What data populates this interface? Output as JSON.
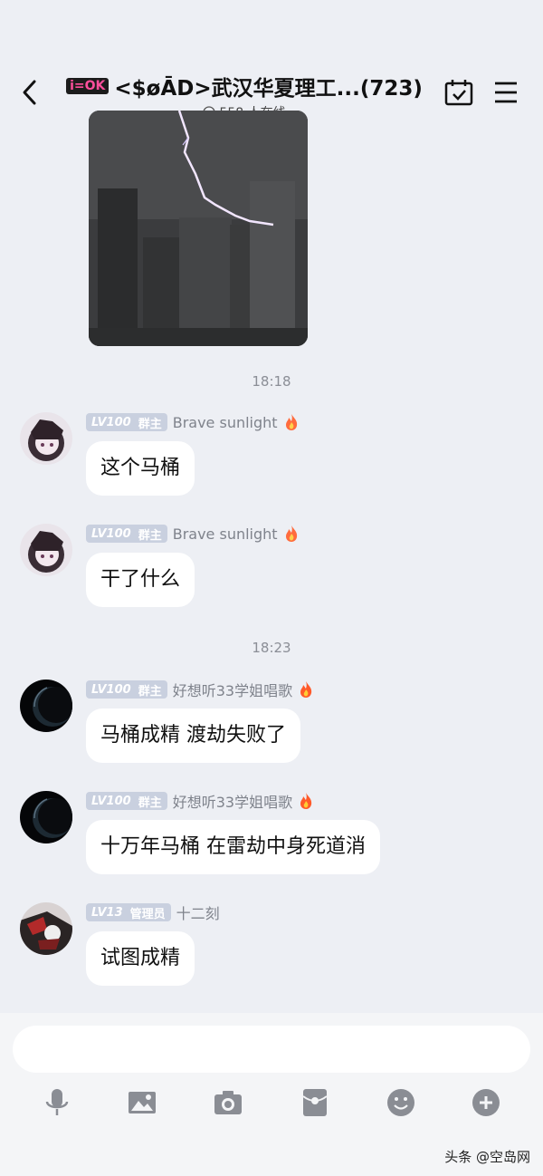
{
  "header": {
    "badge": "i=OK",
    "title": "<$øĀD>武汉华夏理工...(723)",
    "online": "558 人在线"
  },
  "messages": [
    {
      "type": "image",
      "description": "lightning-photo"
    },
    {
      "type": "time",
      "text": "18:18"
    },
    {
      "type": "text",
      "level": "LV100",
      "role": "群主",
      "sender": "Brave sunlight",
      "text": "这个马桶"
    },
    {
      "type": "text",
      "level": "LV100",
      "role": "群主",
      "sender": "Brave sunlight",
      "text": "干了什么"
    },
    {
      "type": "time",
      "text": "18:23"
    },
    {
      "type": "text",
      "level": "LV100",
      "role": "群主",
      "sender": "好想听33学姐唱歌",
      "text": "马桶成精 渡劫失败了"
    },
    {
      "type": "text",
      "level": "LV100",
      "role": "群主",
      "sender": "好想听33学姐唱歌",
      "text": "十万年马桶 在雷劫中身死道消"
    },
    {
      "type": "text",
      "level": "LV13",
      "role": "管理员",
      "sender": "十二刻",
      "text": "试图成精"
    }
  ],
  "input": {
    "placeholder": ""
  },
  "toolbar": [
    "microphone-icon",
    "image-icon",
    "camera-icon",
    "red-packet-icon",
    "emoji-icon",
    "plus-icon"
  ],
  "watermark": "头条 @空岛网"
}
